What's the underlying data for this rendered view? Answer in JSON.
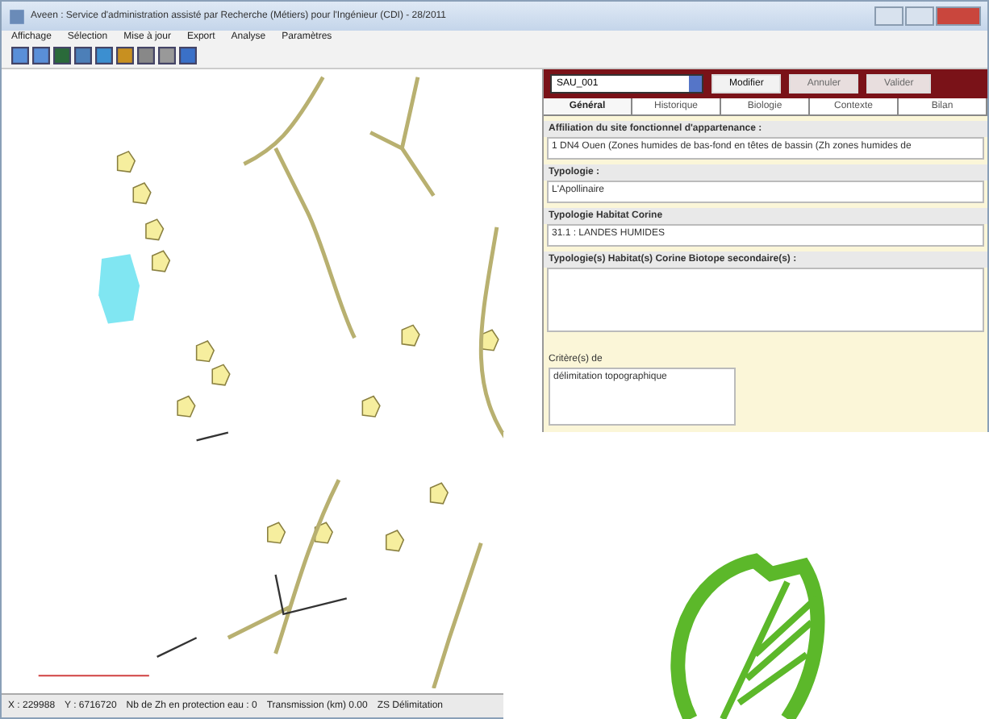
{
  "window": {
    "title": "Aveen : Service d'administration assisté par Recherche (Métiers) pour l'Ingénieur (CDI) - 28/2011"
  },
  "menu": [
    "Affichage",
    "Sélection",
    "Mise à jour",
    "Export",
    "Analyse",
    "Paramètres"
  ],
  "panel": {
    "record": "SAU_001",
    "buttons": [
      {
        "label": "Modifier",
        "disabled": false
      },
      {
        "label": "Annuler",
        "disabled": true
      },
      {
        "label": "Valider",
        "disabled": true
      }
    ],
    "tabs": [
      {
        "label": "Général",
        "selected": true
      },
      {
        "label": "Historique",
        "selected": false
      },
      {
        "label": "Biologie",
        "selected": false
      },
      {
        "label": "Contexte",
        "selected": false
      },
      {
        "label": "Bilan",
        "selected": false
      }
    ],
    "fields": [
      {
        "label": "Affiliation du site fonctionnel d'appartenance :",
        "value": "1 DN4 Ouen (Zones humides de bas-fond en têtes de bassin (Zh zones humides de"
      },
      {
        "label": "Typologie :",
        "value": "L'Apollinaire"
      },
      {
        "label": "Typologie Habitat Corine",
        "value": "31.1 : LANDES HUMIDES"
      },
      {
        "label": "Typologie(s) Habitat(s) Corine Biotope secondaire(s) :"
      }
    ],
    "criteria": {
      "label": "Critère(s) de",
      "items": [
        "délimitation topographique"
      ]
    }
  },
  "status_bar": [
    "X : 229988",
    "Y : 6716720",
    "Nb de Zh en protection eau : 0",
    "Transmission (km) 0.00",
    "ZS Délimitation"
  ]
}
